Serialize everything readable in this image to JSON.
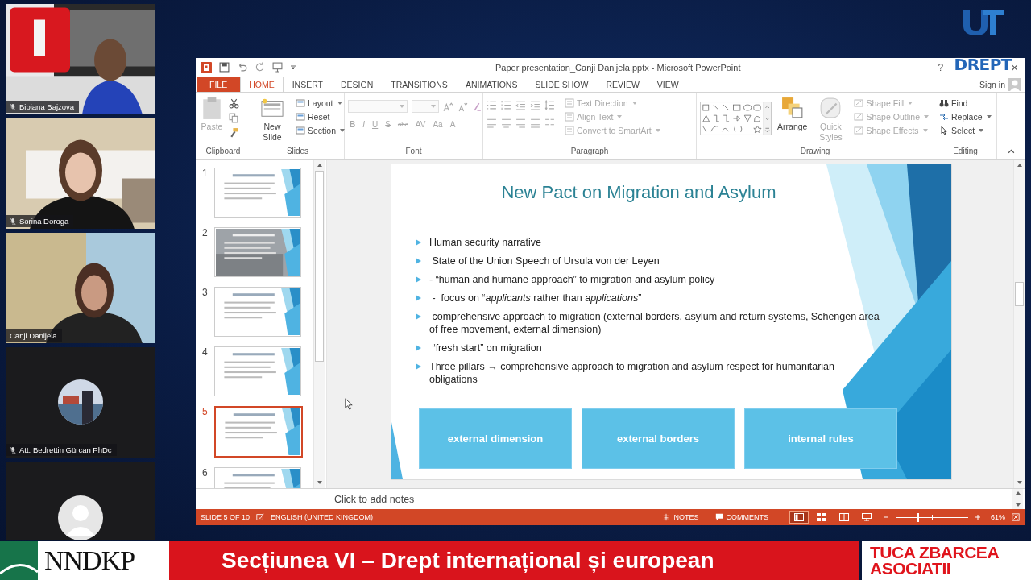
{
  "participants": [
    {
      "kind": "video",
      "name": "Bibiana Bajzova",
      "muted": true
    },
    {
      "kind": "video",
      "name": "Sorina Doroga",
      "muted": true
    },
    {
      "kind": "video",
      "name": "Canji Danijela",
      "muted": false
    },
    {
      "kind": "photo_avatar",
      "name": "Att. Bedrettin Gürcan PhDc",
      "muted": true
    },
    {
      "kind": "blank_avatar"
    }
  ],
  "logo": {
    "text": "DREPT"
  },
  "window": {
    "title": "Paper presentation_Canji Danijela.pptx - Microsoft PowerPoint",
    "help": "?",
    "close": "×"
  },
  "tabs": [
    {
      "label": "FILE",
      "kind": "file",
      "selected": false
    },
    {
      "label": "HOME",
      "kind": "tab",
      "selected": true
    },
    {
      "label": "INSERT",
      "kind": "tab",
      "selected": false
    },
    {
      "label": "DESIGN",
      "kind": "tab",
      "selected": false
    },
    {
      "label": "TRANSITIONS",
      "kind": "tab",
      "selected": false
    },
    {
      "label": "ANIMATIONS",
      "kind": "tab",
      "selected": false
    },
    {
      "label": "SLIDE SHOW",
      "kind": "tab",
      "selected": false
    },
    {
      "label": "REVIEW",
      "kind": "tab",
      "selected": false
    },
    {
      "label": "VIEW",
      "kind": "tab",
      "selected": false
    }
  ],
  "sign_in": "Sign in",
  "ribbon": {
    "clipboard": {
      "label": "Clipboard",
      "paste": {
        "label": "Paste",
        "disabled": true
      }
    },
    "slides": {
      "label": "Slides",
      "new_slide": {
        "label": "New Slide",
        "disabled": false
      },
      "layout": {
        "label": "Layout",
        "disabled": false
      },
      "reset": {
        "label": "Reset",
        "disabled": false
      },
      "section": {
        "label": "Section",
        "disabled": false
      }
    },
    "font": {
      "label": "Font",
      "disabled": true,
      "buttons": [
        "B",
        "I",
        "U",
        "S",
        "abc",
        "AV",
        "Aa",
        "A"
      ]
    },
    "paragraph": {
      "label": "Paragraph",
      "text_direction": {
        "label": "Text Direction",
        "disabled": true
      },
      "align_text": {
        "label": "Align Text",
        "disabled": true
      },
      "convert": {
        "label": "Convert to SmartArt",
        "disabled": true
      }
    },
    "drawing": {
      "label": "Drawing",
      "arrange": {
        "label": "Arrange",
        "disabled": false
      },
      "quick_styles": {
        "label": "Quick Styles",
        "disabled": true
      },
      "shape_fill": {
        "label": "Shape Fill",
        "disabled": true
      },
      "shape_outline": {
        "label": "Shape Outline",
        "disabled": true
      },
      "shape_effects": {
        "label": "Shape Effects",
        "disabled": true
      }
    },
    "editing": {
      "label": "Editing",
      "find": {
        "label": "Find",
        "disabled": false
      },
      "replace": {
        "label": "Replace",
        "disabled": false
      },
      "select": {
        "label": "Select",
        "disabled": false
      }
    }
  },
  "thumbnails": [
    {
      "number": "1",
      "kind": "text",
      "selected": false
    },
    {
      "number": "2",
      "selected": false
    },
    {
      "number": "3",
      "kind": "text",
      "selected": false
    },
    {
      "number": "4",
      "kind": "text",
      "selected": false
    },
    {
      "number": "5",
      "kind": "text",
      "selected": true
    },
    {
      "number": "6",
      "kind": "text",
      "selected": false
    }
  ],
  "slide": {
    "title": "New Pact on Migration and Asylum",
    "bullets": [
      "Human security narrative",
      " State of the Union Speech of Ursula von der Leyen",
      "- “human and humane approach” to migration and asylum policy",
      " -  focus on “*applicants* rather than *applications*”",
      " comprehensive approach to migration (external borders, asylum and return systems, Schengen area of free movement, external dimension)",
      " “fresh start” on migration",
      "Three pillars → comprehensive approach to migration and asylum respect for humanitarian obligations"
    ],
    "boxes": [
      "external dimension",
      "external borders",
      "internal rules"
    ]
  },
  "notes_placeholder": "Click to add notes",
  "status_bar": {
    "slide_info": "SLIDE 5 OF 10",
    "language": "ENGLISH (UNITED KINGDOM)",
    "notes": "NOTES",
    "comments": "COMMENTS",
    "views": [
      {
        "kind": "normal",
        "selected": true
      },
      {
        "kind": "sorter",
        "selected": false
      },
      {
        "kind": "reading",
        "selected": false
      },
      {
        "kind": "slideshow",
        "selected": false
      }
    ],
    "zoom": {
      "level": 0.3,
      "reading": "61%"
    }
  },
  "banner": {
    "left_logo": "NNDKP",
    "title": "Secțiunea VI – Drept internațional și european",
    "right_logo": [
      "TUCA ZBARCEA",
      "ASOCIATII"
    ]
  }
}
